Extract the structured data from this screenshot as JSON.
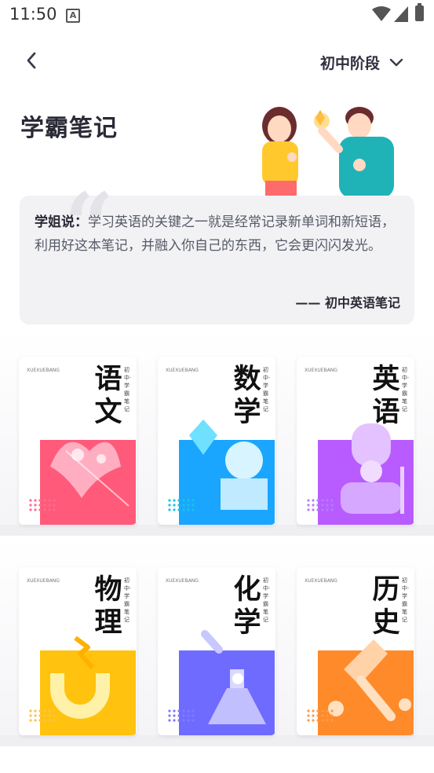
{
  "status": {
    "time": "11:50",
    "notif": "A"
  },
  "header": {
    "stage": "初中阶段"
  },
  "title": "学霸笔记",
  "quote": {
    "label": "学姐说：",
    "text": "学习英语的关键之一就是经常记录新单词和新短语，利用好这本笔记，并融入你自己的东西，它会更闪闪发光。",
    "sign": "—— 初中英语笔记"
  },
  "books": [
    {
      "subject": "语文",
      "line1": "语",
      "line2": "文",
      "tag": "初中·学霸笔记",
      "vert": "XUEXUEBANG",
      "color": "#ff5a7a",
      "dot": "#ff6b8a",
      "art": "flower"
    },
    {
      "subject": "数学",
      "line1": "数",
      "line2": "学",
      "tag": "初中·学霸笔记",
      "vert": "XUEXUEBANG",
      "color": "#1aa6ff",
      "dot": "#1ac4e0",
      "art": "geo"
    },
    {
      "subject": "英语",
      "line1": "英",
      "line2": "语",
      "tag": "初中·学霸笔记",
      "vert": "XUEXUEBANG",
      "color": "#b85cff",
      "dot": "#b47cff",
      "art": "guard"
    },
    {
      "subject": "物理",
      "line1": "物",
      "line2": "理",
      "tag": "初中·学霸笔记",
      "vert": "XUEXUEBANG",
      "color": "#ffc20e",
      "dot": "#ffc24a",
      "art": "magnet"
    },
    {
      "subject": "化学",
      "line1": "化",
      "line2": "学",
      "tag": "初中·学霸笔记",
      "vert": "XUEXUEBANG",
      "color": "#6f6bff",
      "dot": "#7f7bff",
      "art": "flask"
    },
    {
      "subject": "历史",
      "line1": "历",
      "line2": "史",
      "tag": "初中·学霸笔记",
      "vert": "XUEXUEBANG",
      "color": "#ff8a2a",
      "dot": "#ff9a4a",
      "art": "torch"
    }
  ]
}
